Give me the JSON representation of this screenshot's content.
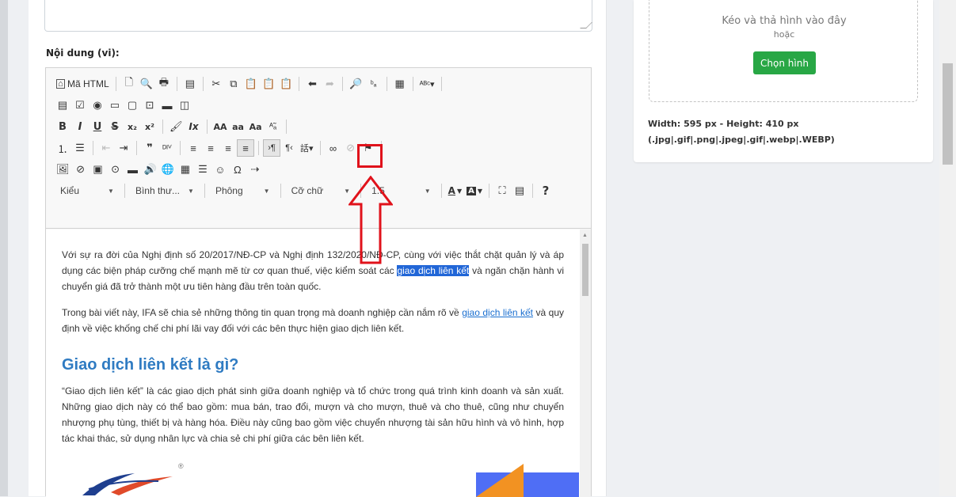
{
  "form": {
    "content_label": "Nội dung (vi):"
  },
  "toolbar": {
    "row1": [
      "Mã HTML"
    ],
    "row3_text": {
      "bold": "B",
      "italic": "I",
      "underline": "U",
      "strike": "S",
      "subscript": "x₂",
      "superscript": "x²",
      "clear": "Ix",
      "upper": "AA",
      "lower": "aa",
      "capital": "Aa"
    },
    "format_select": "Kiểu",
    "paragraph_select": "Bình thư...",
    "font_select": "Phông",
    "size_select": "Cỡ chữ",
    "lineheight_select": "1.5",
    "text_color": "A",
    "help": "?"
  },
  "content": {
    "p1_a": "Với sự ra đời của Nghị định số 20/2017/NĐ-CP và Nghị định 132/2020/NĐ-CP, cùng với việc thắt chặt quản lý và áp dụng các biện pháp cưỡng chế mạnh mẽ từ cơ quan thuế, việc kiểm soát các ",
    "p1_hl": "giao dịch liên kết",
    "p1_b": " và ngăn chặn hành vi chuyển giá đã trở thành một ưu tiên hàng đầu trên toàn quốc.",
    "p2_a": "Trong bài viết này, IFA sẽ chia sẻ những thông tin quan trọng mà doanh nghiệp cần nắm rõ về ",
    "p2_link": "giao dịch liên kết",
    "p2_b": " và quy định về việc khống chế chi phí lãi vay đối với các bên thực hiện giao dịch liên kết.",
    "heading": "Giao dịch liên kết là gì?",
    "p3": "“Giao dịch liên kết” là các giao dịch phát sinh giữa doanh nghiệp và tổ chức trong quá trình kinh doanh và sản xuất. Những giao dịch này có thể bao gồm: mua bán, trao đổi, mượn và cho mượn, thuê và cho thuê, cũng như chuyển nhượng phụ tùng, thiết bị và hàng hóa. Điều này cũng bao gồm việc chuyển nhượng tài sản hữu hình và vô hình, hợp tác khai thác, sử dụng nhân lực và chia sẻ chi phí giữa các bên liên kết.",
    "reg_mark": "®"
  },
  "upload": {
    "drop_text": "Kéo và thả hình vào đây",
    "or_text": "hoặc",
    "choose_button": "Chọn hình",
    "dimensions": "Width: 595 px - Height: 410 px",
    "formats": "(.jpg|.gif|.png|.jpeg|.gif|.webp|.WEBP)"
  },
  "colors": {
    "accent_green": "#28a745",
    "heading_blue": "#2f7bc2",
    "highlight_blue": "#2166d7",
    "annotation_red": "#e0121b"
  }
}
